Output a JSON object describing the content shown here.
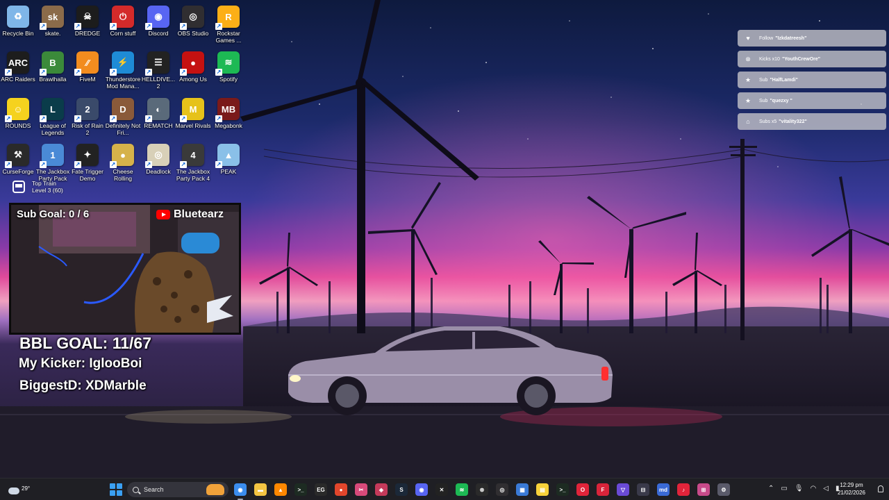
{
  "desktop_icons": [
    {
      "label": "Recycle Bin",
      "icon": "recycle-bin-icon",
      "color": "#7fb6e8",
      "glyph": "♻"
    },
    {
      "label": "skate.",
      "icon": "skate-icon",
      "color": "#8b6b4a",
      "glyph": "sk"
    },
    {
      "label": "DREDGE",
      "icon": "dredge-icon",
      "color": "#1c1c1c",
      "glyph": "☠"
    },
    {
      "label": "Corn stuff",
      "icon": "corn-stuff-icon",
      "color": "#d42a2a",
      "glyph": "⏻"
    },
    {
      "label": "Discord",
      "icon": "discord-icon",
      "color": "#5865f2",
      "glyph": "◉"
    },
    {
      "label": "OBS Studio",
      "icon": "obs-studio-icon",
      "color": "#302e31",
      "glyph": "◎"
    },
    {
      "label": "Rockstar Games ...",
      "icon": "rockstar-games-icon",
      "color": "#fcaf17",
      "glyph": "R"
    },
    {
      "label": "ARC Raiders",
      "icon": "arc-raiders-icon",
      "color": "#1d1d1d",
      "glyph": "ARC"
    },
    {
      "label": "Brawlhalla",
      "icon": "brawlhalla-icon",
      "color": "#3b8a3a",
      "glyph": "B"
    },
    {
      "label": "FiveM",
      "icon": "fivem-icon",
      "color": "#f28c1f",
      "glyph": "⁄⁄"
    },
    {
      "label": "Thunderstore Mod Mana...",
      "icon": "thunderstore-icon",
      "color": "#1e8bd6",
      "glyph": "⚡"
    },
    {
      "label": "HELLDIVE... 2",
      "icon": "helldivers-icon",
      "color": "#222222",
      "glyph": "☰"
    },
    {
      "label": "Among Us",
      "icon": "among-us-icon",
      "color": "#c51111",
      "glyph": "●"
    },
    {
      "label": "Spotify",
      "icon": "spotify-icon",
      "color": "#1db954",
      "glyph": "≋"
    },
    {
      "label": "ROUNDS",
      "icon": "rounds-icon",
      "color": "#f5d21e",
      "glyph": "☺"
    },
    {
      "label": "League of Legends",
      "icon": "league-of-legends-icon",
      "color": "#0a3c4a",
      "glyph": "L"
    },
    {
      "label": "Risk of Rain 2",
      "icon": "risk-of-rain-2-icon",
      "color": "#3a4a6a",
      "glyph": "2"
    },
    {
      "label": "Definitely Not Fri...",
      "icon": "definitely-not-fried-icon",
      "color": "#8a5a3a",
      "glyph": "D"
    },
    {
      "label": "REMATCH",
      "icon": "rematch-icon",
      "color": "#5a6a7a",
      "glyph": "◐"
    },
    {
      "label": "Marvel Rivals",
      "icon": "marvel-rivals-icon",
      "color": "#e6c21a",
      "glyph": "M"
    },
    {
      "label": "Megabonk",
      "icon": "megabonk-icon",
      "color": "#7a1a1a",
      "glyph": "MB"
    },
    {
      "label": "CurseForge",
      "icon": "curseforge-icon",
      "color": "#2a2a2a",
      "glyph": "⚒"
    },
    {
      "label": "The Jackbox Party Pack",
      "icon": "jackbox-party-pack-icon",
      "color": "#4a8ad6",
      "glyph": "1"
    },
    {
      "label": "Fate Trigger Demo",
      "icon": "fate-trigger-icon",
      "color": "#222222",
      "glyph": "✦"
    },
    {
      "label": "Cheese Rolling",
      "icon": "cheese-rolling-icon",
      "color": "#d6b24a",
      "glyph": "●"
    },
    {
      "label": "Deadlock",
      "icon": "deadlock-icon",
      "color": "#d8d0b8",
      "glyph": "◎"
    },
    {
      "label": "The Jackbox Party Pack 4",
      "icon": "jackbox-party-pack-4-icon",
      "color": "#3a3a3a",
      "glyph": "4"
    },
    {
      "label": "PEAK",
      "icon": "peak-icon",
      "color": "#8ac0e8",
      "glyph": "▲"
    }
  ],
  "train_widget": {
    "line1": "Top Train",
    "line2": "Level 3  (60)"
  },
  "webcam": {
    "sub_goal": "Sub Goal:  0 / 6",
    "channel_name": "Bluetearz"
  },
  "overlay_text": {
    "bbl_goal": "BBL GOAL: 11/67",
    "kicker": "My Kicker: IglooBoi",
    "biggest_d": "BiggestD: XDMarble"
  },
  "alerts": [
    {
      "icon": "heart-icon",
      "glyph": "♥",
      "action": "Follow",
      "user": "\"Izkdatreesh\""
    },
    {
      "icon": "kick-icon",
      "glyph": "⊗",
      "action": "Kicks x10",
      "user": "\"YouthCrewOre\""
    },
    {
      "icon": "star-icon",
      "glyph": "★",
      "action": "Sub",
      "user": "\"HalfLamdi\""
    },
    {
      "icon": "star-icon",
      "glyph": "★",
      "action": "Sub",
      "user": "\"quezxy \""
    },
    {
      "icon": "gift-icon",
      "glyph": "⌂",
      "action": "Subs x5",
      "user": "\"vitality322\""
    }
  ],
  "taskbar": {
    "weather_temp": "29°",
    "search_placeholder": "Search",
    "apps": [
      {
        "icon": "chrome-icon",
        "color": "#3b8ded",
        "glyph": "◉",
        "active": true
      },
      {
        "icon": "file-explorer-icon",
        "color": "#f4c542",
        "glyph": "▬",
        "active": false
      },
      {
        "icon": "vlc-icon",
        "color": "#ff8800",
        "glyph": "▲",
        "active": false
      },
      {
        "icon": "terminal-icon",
        "color": "#1d2b22",
        "glyph": ">_",
        "active": false
      },
      {
        "icon": "epic-games-icon",
        "color": "#2a2a2a",
        "glyph": "EG",
        "active": false
      },
      {
        "icon": "brave-icon",
        "color": "#e2462c",
        "glyph": "●",
        "active": false
      },
      {
        "icon": "snipping-tool-icon",
        "color": "#d84a7a",
        "glyph": "✂",
        "active": false
      },
      {
        "icon": "davinci-resolve-icon",
        "color": "#c43a5a",
        "glyph": "◈",
        "active": false
      },
      {
        "icon": "steam-icon",
        "color": "#1b2838",
        "glyph": "S",
        "active": false
      },
      {
        "icon": "discord-icon",
        "color": "#5865f2",
        "glyph": "◉",
        "active": false
      },
      {
        "icon": "capcut-icon",
        "color": "#222222",
        "glyph": "✕",
        "active": false
      },
      {
        "icon": "spotify-icon",
        "color": "#1db954",
        "glyph": "≋",
        "active": false
      },
      {
        "icon": "xbox-icon",
        "color": "#2a2a2a",
        "glyph": "⊗",
        "active": false
      },
      {
        "icon": "obs-studio-icon",
        "color": "#302e31",
        "glyph": "◎",
        "active": false
      },
      {
        "icon": "photos-icon",
        "color": "#3a7ad6",
        "glyph": "▦",
        "active": false
      },
      {
        "icon": "sticky-notes-icon",
        "color": "#f7d23a",
        "glyph": "▤",
        "active": false
      },
      {
        "icon": "terminal-2-icon",
        "color": "#1d2b22",
        "glyph": ">_",
        "active": false
      },
      {
        "icon": "opera-gx-icon",
        "color": "#e0243a",
        "glyph": "O",
        "active": false
      },
      {
        "icon": "fortnite-tracker-icon",
        "color": "#d8243a",
        "glyph": "F",
        "active": false
      },
      {
        "icon": "proton-vpn-icon",
        "color": "#6a4ad6",
        "glyph": "▽",
        "active": false
      },
      {
        "icon": "settings-icon-2",
        "color": "#3a3a4a",
        "glyph": "⊟",
        "active": false
      },
      {
        "icon": "medal-icon",
        "color": "#3a6ad6",
        "glyph": "md",
        "active": false
      },
      {
        "icon": "tiktok-icon",
        "color": "#e0243a",
        "glyph": "♪",
        "active": false
      },
      {
        "icon": "game-bar-icon",
        "color": "#c84a8a",
        "glyph": "⊞",
        "active": false
      },
      {
        "icon": "settings-icon",
        "color": "#5a5a6a",
        "glyph": "⚙",
        "active": false
      }
    ],
    "tray_icons": [
      "chevron-up-icon",
      "battery-icon",
      "microphone-icon",
      "wifi-icon",
      "speaker-icon",
      "battery-level-icon"
    ],
    "time": "12:29 pm",
    "date": "21/02/2026"
  }
}
